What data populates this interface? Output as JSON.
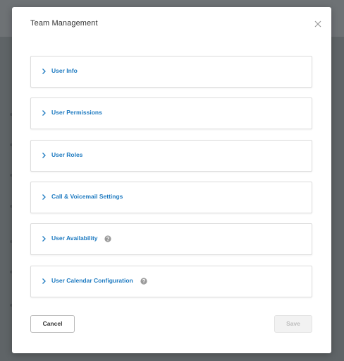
{
  "modal": {
    "title": "Team Management",
    "sections": [
      {
        "label": "User Info",
        "has_help": false
      },
      {
        "label": "User Permissions",
        "has_help": false
      },
      {
        "label": "User Roles",
        "has_help": false
      },
      {
        "label": "Call & Voicemail Settings",
        "has_help": false
      },
      {
        "label": "User Availability",
        "has_help": true
      },
      {
        "label": "User Calendar Configuration",
        "has_help": true
      }
    ],
    "cancel_label": "Cancel",
    "save_label": "Save",
    "save_enabled": false
  },
  "icons": {
    "close": "close-icon",
    "expand": "chevron-right-icon",
    "help": "help-circle-icon"
  },
  "colors": {
    "accent": "#1f7bc1",
    "overlay": "#5f6467",
    "help_icon": "#9a9a9a"
  }
}
